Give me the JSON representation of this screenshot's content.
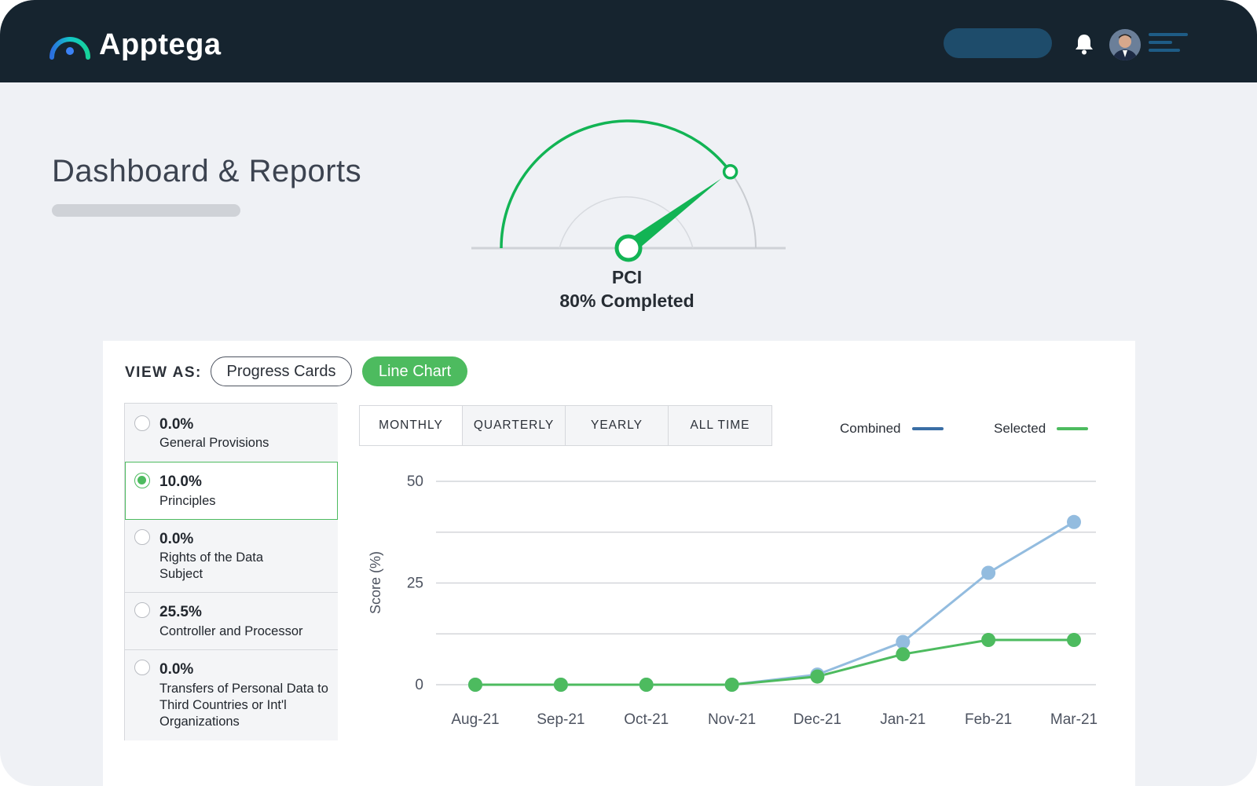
{
  "app": {
    "brand": "Apptega",
    "logo_icon": "apptega-arc-logo",
    "header_icons": [
      "bell-icon",
      "user-avatar",
      "menu-lines-icon"
    ]
  },
  "page": {
    "title": "Dashboard & Reports"
  },
  "gauge": {
    "framework": "PCI",
    "status": "80% Completed",
    "progress": 0.8,
    "color": "#12b454"
  },
  "view_as": {
    "label": "VIEW AS:",
    "options": [
      "Progress Cards",
      "Line Chart"
    ],
    "selected": "Line Chart"
  },
  "categories": [
    {
      "percent": "0.0%",
      "name": "General Provisions",
      "selected": false
    },
    {
      "percent": "10.0%",
      "name": "Principles",
      "selected": true
    },
    {
      "percent": "0.0%",
      "name": "Rights of the Data Subject",
      "selected": false
    },
    {
      "percent": "25.5%",
      "name": "Controller and Processor",
      "selected": false
    },
    {
      "percent": "0.0%",
      "name": "Transfers of Personal Data to Third Countries or Int'l Organizations",
      "selected": false
    }
  ],
  "periods": {
    "tabs": [
      "MONTHLY",
      "QUARTERLY",
      "YEARLY",
      "ALL TIME"
    ],
    "active": "MONTHLY"
  },
  "chart_data": {
    "type": "line",
    "x": [
      "Aug-21",
      "Sep-21",
      "Oct-21",
      "Nov-21",
      "Dec-21",
      "Jan-21",
      "Feb-21",
      "Mar-21"
    ],
    "ylabel": "Score (%)",
    "xlabel": "",
    "ylim": [
      0,
      50
    ],
    "yticks": [
      0,
      25,
      50
    ],
    "grid": true,
    "legend_position": "top-right",
    "series": [
      {
        "name": "Combined",
        "color": "#3a6ea5",
        "point_color": "#93bcdf",
        "values": [
          0,
          0,
          0,
          0,
          2.5,
          10.5,
          27.5,
          40
        ]
      },
      {
        "name": "Selected",
        "color": "#4dbb5f",
        "point_color": "#4dbb5f",
        "values": [
          0,
          0,
          0,
          0,
          2,
          7.5,
          11,
          11
        ]
      }
    ]
  }
}
